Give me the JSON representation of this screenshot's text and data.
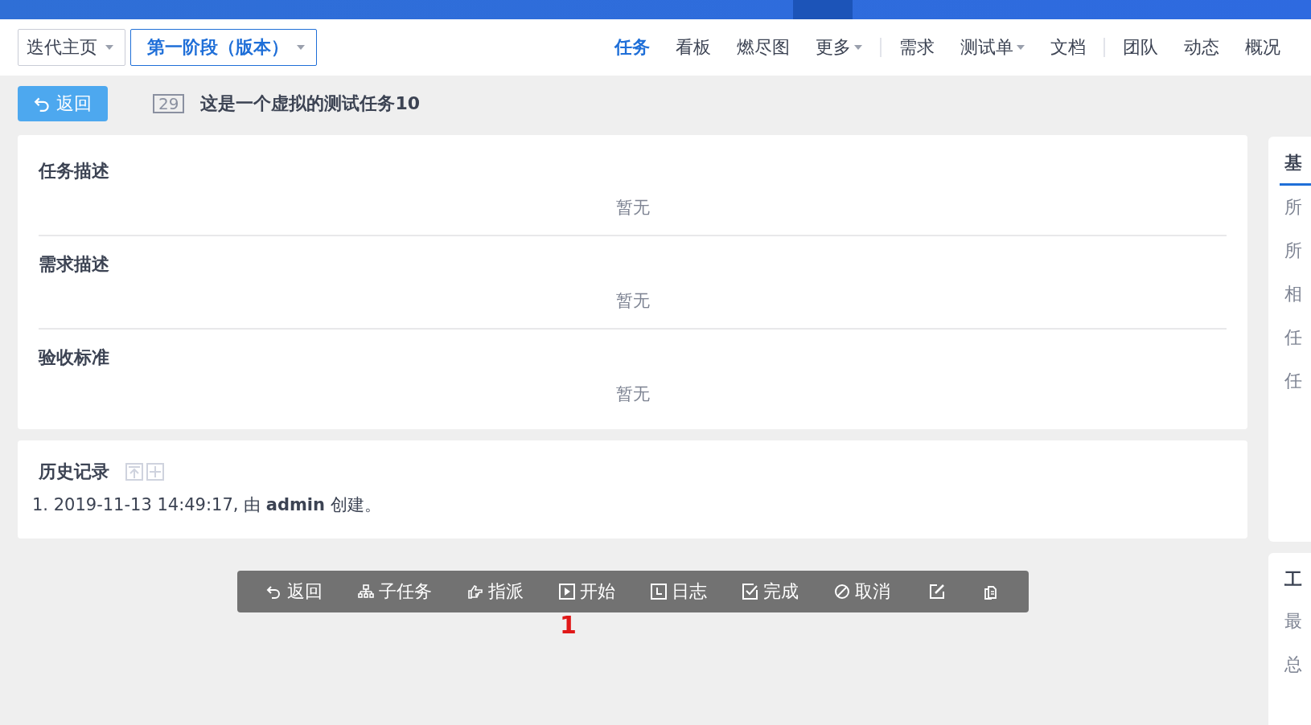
{
  "breadcrumb": [
    {
      "label": "迭代主页",
      "selected": false
    },
    {
      "label": "第一阶段（版本）",
      "selected": true
    }
  ],
  "nav_groups": [
    {
      "tabs": [
        {
          "label": "任务",
          "selected": true,
          "dropdown": false
        },
        {
          "label": "看板",
          "selected": false,
          "dropdown": false
        },
        {
          "label": "燃尽图",
          "selected": false,
          "dropdown": false
        },
        {
          "label": "更多",
          "selected": false,
          "dropdown": true
        }
      ]
    },
    {
      "tabs": [
        {
          "label": "需求",
          "selected": false,
          "dropdown": false
        },
        {
          "label": "测试单",
          "selected": false,
          "dropdown": true
        },
        {
          "label": "文档",
          "selected": false,
          "dropdown": false
        }
      ]
    },
    {
      "tabs": [
        {
          "label": "团队",
          "selected": false,
          "dropdown": false
        },
        {
          "label": "动态",
          "selected": false,
          "dropdown": false
        },
        {
          "label": "概况",
          "selected": false,
          "dropdown": false
        }
      ]
    }
  ],
  "back_button": "返回",
  "task": {
    "id": "29",
    "title": "这是一个虚拟的测试任务10"
  },
  "sections": [
    {
      "heading": "任务描述",
      "content": "暂无"
    },
    {
      "heading": "需求描述",
      "content": "暂无"
    },
    {
      "heading": "验收标准",
      "content": "暂无"
    }
  ],
  "history": {
    "heading": "历史记录",
    "entries": [
      "1. 2019-11-13 14:49:17, 由 **admin** 创建。"
    ]
  },
  "actions": [
    {
      "kind": "back",
      "label": "返回"
    },
    {
      "kind": "tree",
      "label": "子任务"
    },
    {
      "kind": "hand",
      "label": "指派"
    },
    {
      "kind": "play",
      "label": "开始"
    },
    {
      "kind": "clock",
      "label": "日志"
    },
    {
      "kind": "check",
      "label": "完成"
    },
    {
      "kind": "ban",
      "label": "取消"
    },
    {
      "kind": "edit"
    },
    {
      "kind": "copy"
    }
  ],
  "annotation": "1",
  "side_panels": [
    {
      "heading": "基",
      "tabbed": true,
      "rows": [
        "所",
        "所",
        "相",
        "任",
        "任"
      ]
    },
    {
      "heading": "工",
      "tabbed": false,
      "rows": [
        "最",
        "总"
      ]
    }
  ]
}
